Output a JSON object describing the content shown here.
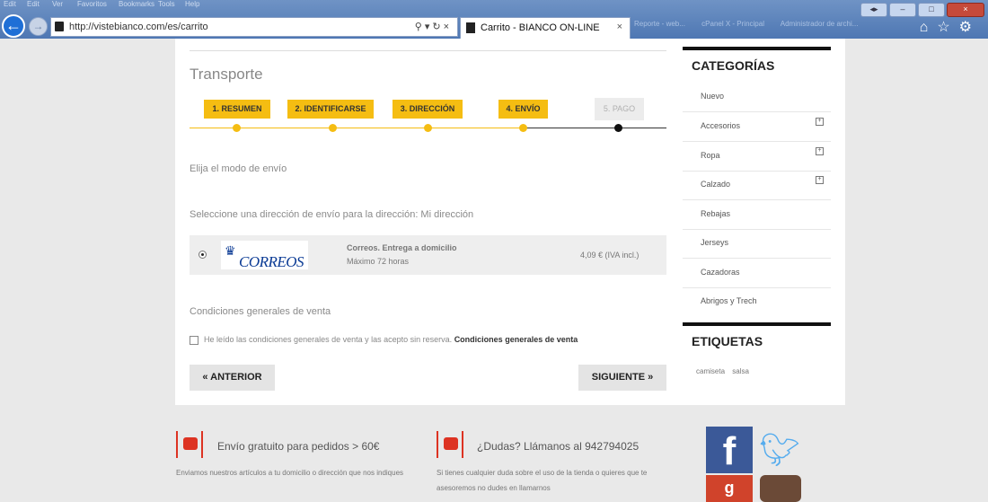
{
  "browser": {
    "menu": [
      "Edit",
      "Edit",
      "Ver",
      "Favoritos",
      "Bookmarks",
      "Tools",
      "Help"
    ],
    "url": "http://vistebianco.com/es/carrito",
    "tab_title": "Carrito - BIANCO ON-LINE",
    "tab_close": "×",
    "ghost_tabs": [
      "Reporte - web...",
      "cPanel X - Principal",
      "Administrador de archi..."
    ]
  },
  "page": {
    "title": "Transporte",
    "steps": [
      {
        "label": "1. RESUMEN",
        "state": "done"
      },
      {
        "label": "2. IDENTIFICARSE",
        "state": "done"
      },
      {
        "label": "3. DIRECCIÓN",
        "state": "done"
      },
      {
        "label": "4. ENVÍO",
        "state": "current"
      },
      {
        "label": "5. PAGO",
        "state": "todo"
      }
    ],
    "choose_mode": "Elija el modo de envío",
    "select_address": "Seleccione una dirección de envío para la dirección: Mi dirección",
    "carrier": {
      "logo_text": "CORREOS",
      "name": "Correos. Entrega a domicilio",
      "delay": "Máximo 72 horas",
      "price": "4,09 € (IVA incl.)"
    },
    "terms_heading": "Condiciones generales de venta",
    "terms_text": "He leído las condiciones generales de venta y las acepto sin reserva.",
    "terms_link": "Condiciones generales de venta",
    "prev_button": "« ANTERIOR",
    "next_button": "SIGUIENTE »"
  },
  "sidebar": {
    "categories_heading": "CATEGORÍAS",
    "categories": [
      {
        "label": "Nuevo",
        "expandable": false
      },
      {
        "label": "Accesorios",
        "expandable": true
      },
      {
        "label": "Ropa",
        "expandable": true
      },
      {
        "label": "Calzado",
        "expandable": true
      },
      {
        "label": "Rebajas",
        "expandable": false
      },
      {
        "label": "Jerseys",
        "expandable": false
      },
      {
        "label": "Cazadoras",
        "expandable": false
      },
      {
        "label": "Abrigos y Trech",
        "expandable": false
      }
    ],
    "tags_heading": "ETIQUETAS",
    "tags": [
      "camiseta",
      "salsa"
    ]
  },
  "footer": {
    "shipping_title": "Envío gratuito para pedidos > 60€",
    "shipping_text": "Enviamos nuestros artículos a tu domicilio o dirección que nos indiques",
    "call_title": "¿Dudas? Llámanos al 942794025",
    "call_text": "Si tienes cualquier duda sobre el uso de la tienda o quieres que te asesoremos no dudes en llamarnos"
  },
  "colors": {
    "accent": "#f5bd12",
    "footer_icon": "#dd3322",
    "facebook": "#3b5998",
    "twitter": "#55acee"
  }
}
